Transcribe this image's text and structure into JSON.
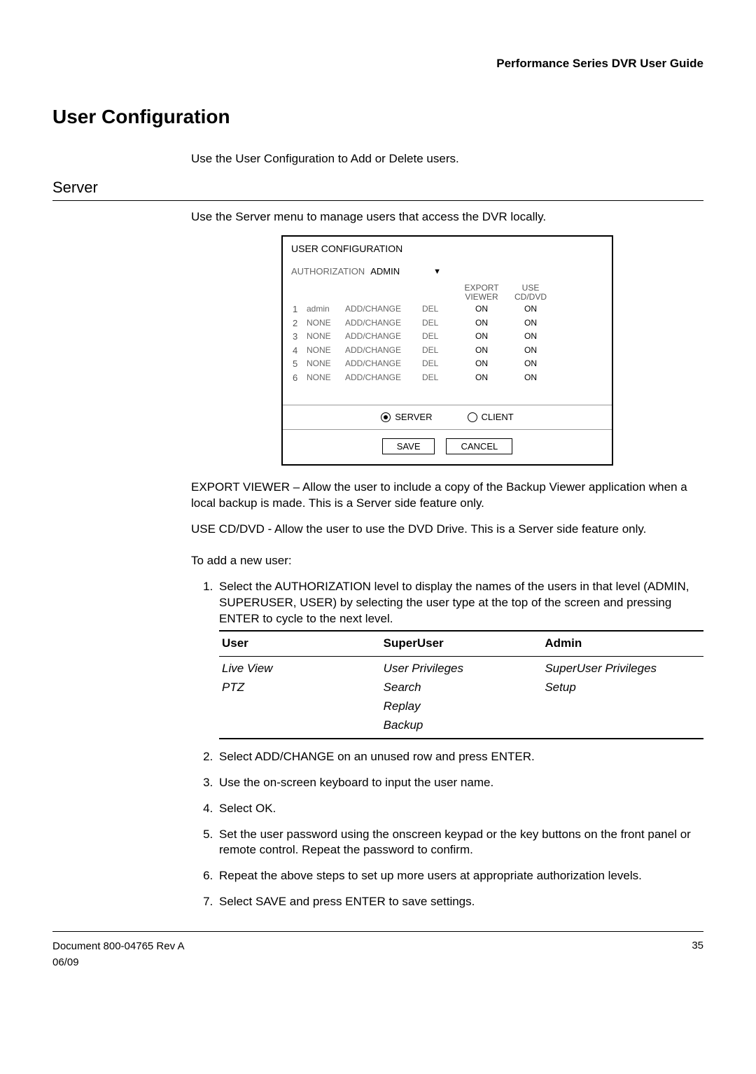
{
  "header": "Performance Series DVR User Guide",
  "h1": "User Configuration",
  "intro": "Use the User Configuration to Add or Delete users.",
  "subsection": "Server",
  "server_intro": "Use the Server menu to manage users that access the DVR locally.",
  "figure": {
    "title": "USER CONFIGURATION",
    "auth_label": "AUTHORIZATION",
    "auth_value": "ADMIN",
    "cols": {
      "export": "EXPORT VIEWER",
      "use": "USE CD/DVD"
    },
    "rows": [
      {
        "n": "1",
        "user": "admin",
        "ac": "ADD/CHANGE",
        "del": "DEL",
        "ev": "ON",
        "cd": "ON"
      },
      {
        "n": "2",
        "user": "NONE",
        "ac": "ADD/CHANGE",
        "del": "DEL",
        "ev": "ON",
        "cd": "ON"
      },
      {
        "n": "3",
        "user": "NONE",
        "ac": "ADD/CHANGE",
        "del": "DEL",
        "ev": "ON",
        "cd": "ON"
      },
      {
        "n": "4",
        "user": "NONE",
        "ac": "ADD/CHANGE",
        "del": "DEL",
        "ev": "ON",
        "cd": "ON"
      },
      {
        "n": "5",
        "user": "NONE",
        "ac": "ADD/CHANGE",
        "del": "DEL",
        "ev": "ON",
        "cd": "ON"
      },
      {
        "n": "6",
        "user": "NONE",
        "ac": "ADD/CHANGE",
        "del": "DEL",
        "ev": "ON",
        "cd": "ON"
      }
    ],
    "radios": {
      "server": "SERVER",
      "client": "CLIENT"
    },
    "buttons": {
      "save": "SAVE",
      "cancel": "CANCEL"
    }
  },
  "export_desc": "EXPORT VIEWER – Allow the user to include a copy of the Backup Viewer application when a local backup is made. This is a Server side feature only.",
  "cddvd_desc": "USE CD/DVD - Allow the user to use the DVD Drive. This is a Server side feature only.",
  "add_intro": "To add a new user:",
  "steps": [
    "Select the AUTHORIZATION level to display the names of the users in that level (ADMIN, SUPERUSER, USER) by selecting the user type at the top of the screen and pressing ENTER to cycle to the next level.",
    "Select ADD/CHANGE on an unused row and press ENTER.",
    "Use the on-screen keyboard to input the user name.",
    "Select OK.",
    "Set the user password using the onscreen keypad or the key buttons on the front panel or remote control. Repeat the password to confirm.",
    "Repeat the above steps to set up more users at appropriate authorization levels.",
    "Select SAVE and press ENTER to save settings."
  ],
  "priv_table": {
    "headers": [
      "User",
      "SuperUser",
      "Admin"
    ],
    "User": [
      "Live View",
      "PTZ"
    ],
    "SuperUser": [
      "User Privileges",
      "Search",
      "Replay",
      "Backup"
    ],
    "Admin": [
      "SuperUser Privileges",
      "Setup"
    ]
  },
  "footer": {
    "doc": "Document 800-04765  Rev A",
    "date": "06/09",
    "page": "35"
  }
}
